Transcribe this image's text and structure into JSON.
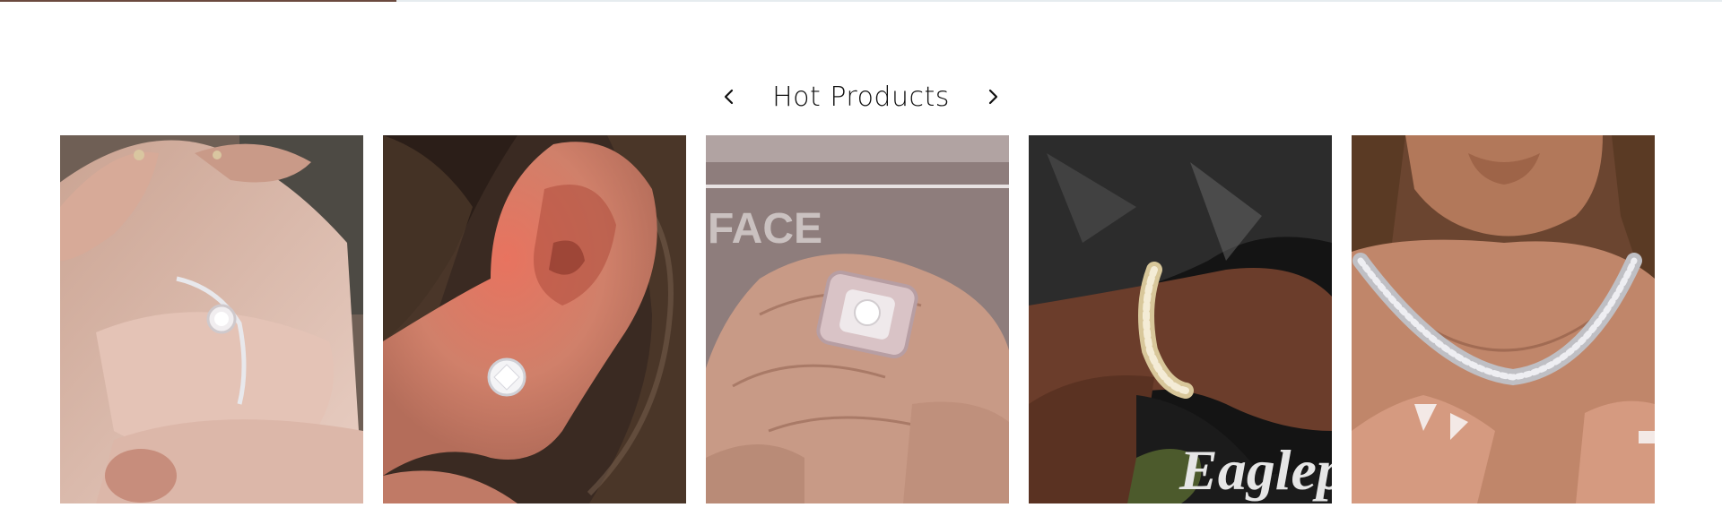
{
  "section": {
    "title": "Hot Products",
    "prev_icon": "chevron-left-icon",
    "next_icon": "chevron-right-icon"
  },
  "carousel_progress": 0.23,
  "products": [
    {
      "image": "silver-ring-on-finger"
    },
    {
      "image": "diamond-stud-earring"
    },
    {
      "image": "mens-diamond-ring",
      "graphic_text": "FACE"
    },
    {
      "image": "iced-cuban-bracelet",
      "graphic_text": "Eaglep"
    },
    {
      "image": "iced-cuban-necklace"
    }
  ]
}
